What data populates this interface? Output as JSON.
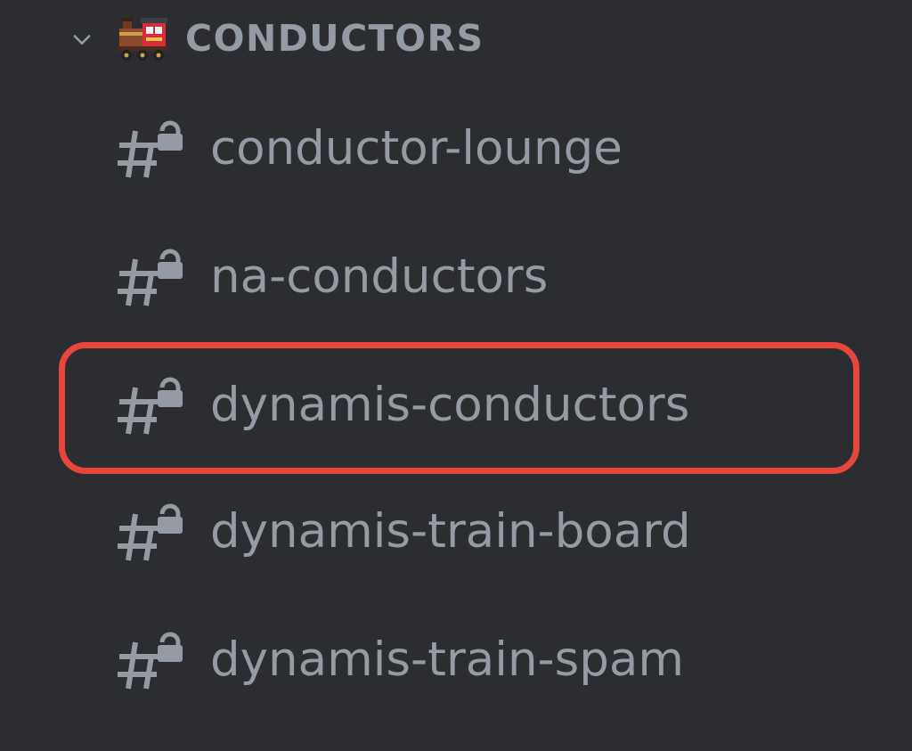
{
  "category": {
    "label": "CONDUCTORS",
    "chevron_icon": "chevron-down-icon",
    "emoji_icon": "train-emoji-icon"
  },
  "channels": [
    {
      "name": "conductor-lounge",
      "icon": "locked-text-channel-icon",
      "highlighted": false
    },
    {
      "name": "na-conductors",
      "icon": "locked-text-channel-icon",
      "highlighted": false
    },
    {
      "name": "dynamis-conductors",
      "icon": "locked-text-channel-icon",
      "highlighted": true
    },
    {
      "name": "dynamis-train-board",
      "icon": "locked-text-channel-icon",
      "highlighted": false
    },
    {
      "name": "dynamis-train-spam",
      "icon": "locked-text-channel-icon",
      "highlighted": false
    }
  ],
  "colors": {
    "background": "#2b2d31",
    "text_muted": "#949ba4",
    "highlight_outline": "#e8463a"
  }
}
